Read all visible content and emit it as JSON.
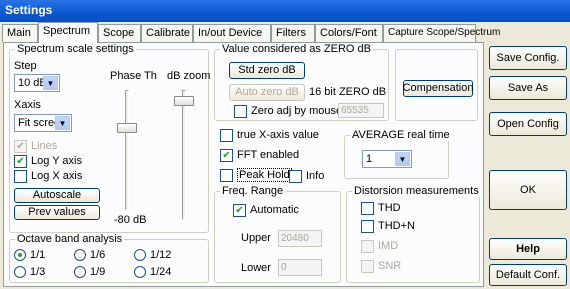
{
  "window": {
    "title": "Settings"
  },
  "tabs": [
    {
      "label": "Main",
      "active": false
    },
    {
      "label": "Spectrum",
      "active": true
    },
    {
      "label": "Scope",
      "active": false
    },
    {
      "label": "Calibrate",
      "active": false
    },
    {
      "label": "In/out Device",
      "active": false
    },
    {
      "label": "Filters",
      "active": false
    },
    {
      "label": "Colors/Font",
      "active": false
    },
    {
      "label": "Capture Scope/Spectrum",
      "active": false
    }
  ],
  "scale": {
    "title": "Spectrum scale settings",
    "step_label": "Step",
    "step_value": "10 dB",
    "xaxis_label": "Xaxis",
    "xaxis_value": "Fit screen",
    "lines_label": "Lines",
    "lines_checked": true,
    "log_y_label": "Log Y axis",
    "log_y_checked": true,
    "log_x_label": "Log X axis",
    "log_x_checked": false,
    "autoscale_label": "Autoscale",
    "prev_label": "Prev values",
    "phase_label": "Phase Th",
    "phase_bottom": "-80 dB",
    "zoom_label": "dB zoom",
    "phase_level": 0.3,
    "zoom_level": 0.05
  },
  "zero": {
    "title": "Value considered as ZERO dB",
    "std_label": "Std zero dB",
    "auto_label": "Auto zero dB",
    "bit_label": "16 bit ZERO dB",
    "adj_label": "Zero adj by mouse",
    "adj_checked": false,
    "value": "65535",
    "compensation_label": "Compensation"
  },
  "options": {
    "true_x_label": "true X-axis value",
    "true_x_checked": false,
    "fft_label": "FFT enabled",
    "fft_checked": true,
    "peak_label": "Peak Hold",
    "peak_checked": false,
    "info_label": "Info",
    "info_checked": false
  },
  "average": {
    "title": "AVERAGE real time",
    "value": "1"
  },
  "freq": {
    "title": "Freq. Range",
    "auto_label": "Automatic",
    "auto_checked": true,
    "upper_label": "Upper",
    "upper_value": "20480",
    "lower_label": "Lower",
    "lower_value": "0"
  },
  "distortion": {
    "title": "Distorsion measurements",
    "thd": "THD",
    "thdn": "THD+N",
    "imd": "IMD",
    "snr": "SNR"
  },
  "octave": {
    "title": "Octave band analysis",
    "opts": [
      "1/1",
      "1/6",
      "1/12",
      "1/3",
      "1/9",
      "1/24"
    ],
    "selected": "1/1"
  },
  "side": {
    "save_config": "Save Config.",
    "save_as": "Save As",
    "open_config": "Open Config",
    "ok": "OK",
    "help": "Help",
    "default": "Default Conf."
  },
  "colors": {
    "titlebar": "#0b57d0",
    "check": "#21a121",
    "panel": "#fcfcfe",
    "face": "#ece9d8"
  }
}
